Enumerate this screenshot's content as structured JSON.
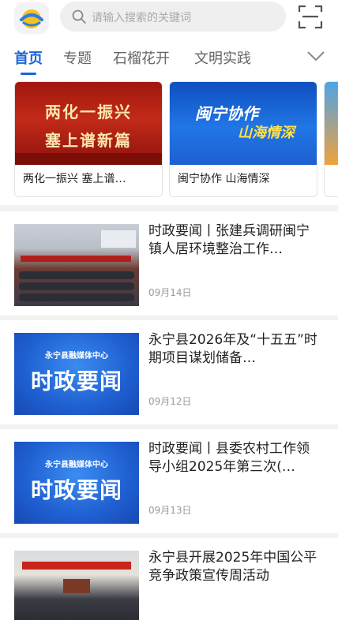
{
  "search": {
    "placeholder": "请输入搜索的关键词"
  },
  "tabs": [
    {
      "label": "首页",
      "active": true
    },
    {
      "label": "专题",
      "active": false
    },
    {
      "label": "石榴花开",
      "active": false
    },
    {
      "label": "文明实践",
      "active": false
    }
  ],
  "banners": [
    {
      "caption": "两化一振兴  塞上谱…",
      "image_line1": "两化一振兴",
      "image_line2": "塞上谱新篇"
    },
    {
      "caption": "闽宁协作  山海情深",
      "image_line1": "闽宁协作",
      "image_line2": "山海情深"
    }
  ],
  "news": [
    {
      "title": "时政要闻丨张建兵调研闽宁镇人居环境整治工作…",
      "date": "09月14日",
      "thumb": "meeting-photo"
    },
    {
      "title": "永宁县2026年及“十五五”时期项目谋划储备…",
      "date": "09月12日",
      "thumb": "shizheng-yaowen-card",
      "thumb_top": "永宁县融媒体中心",
      "thumb_main": "时政要闻"
    },
    {
      "title": "时政要闻丨县委农村工作领导小组2025年第三次(…",
      "date": "09月13日",
      "thumb": "shizheng-yaowen-card",
      "thumb_top": "永宁县融媒体中心",
      "thumb_main": "时政要闻"
    },
    {
      "title": "永宁县开展2025年中国公平竞争政策宣传周活动",
      "date": "",
      "thumb": "hall-photo"
    }
  ],
  "colors": {
    "accent": "#1a64d8",
    "banner_red": "#b0201b",
    "banner_blue": "#1f5fd1"
  },
  "icons": [
    "app-logo-icon",
    "search-icon",
    "scan-icon",
    "chevron-down-icon"
  ]
}
